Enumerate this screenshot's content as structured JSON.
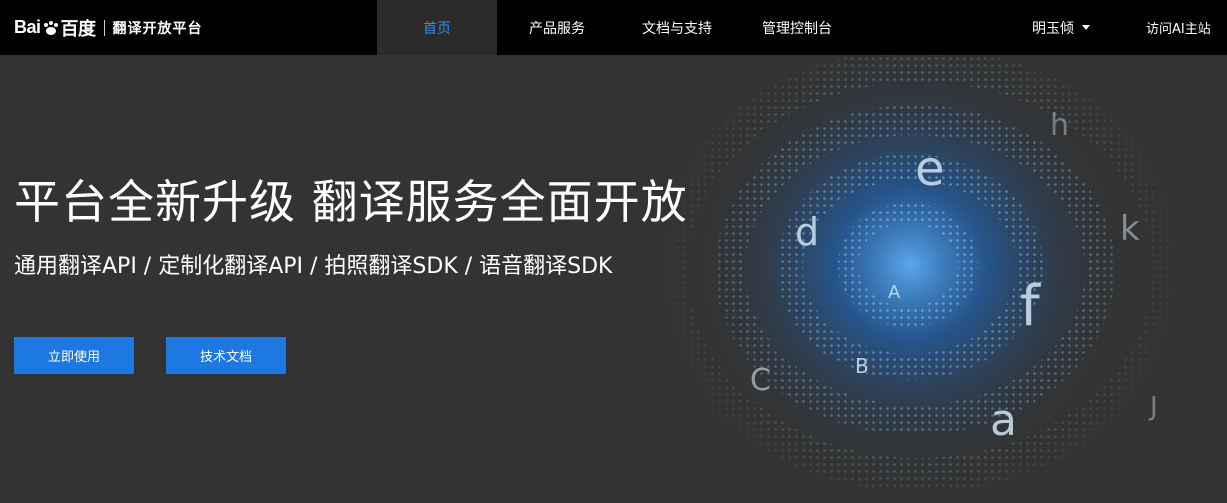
{
  "brand": {
    "logo_text_left": "Bai",
    "logo_text_right": "百度",
    "platform_name": "翻译开放平台"
  },
  "nav": {
    "items": [
      {
        "label": "首页",
        "active": true
      },
      {
        "label": "产品服务",
        "active": false
      },
      {
        "label": "文档与支持",
        "active": false
      },
      {
        "label": "管理控制台",
        "active": false
      }
    ]
  },
  "user": {
    "name": "明玉倾",
    "icon": "chevron-down-icon"
  },
  "visit_link": "访问AI主站",
  "hero": {
    "title": "平台全新升级 翻译服务全面开放",
    "subtitle": "通用翻译API / 定制化翻译API / 拍照翻译SDK / 语音翻译SDK",
    "primary_button": "立即使用",
    "secondary_button": "技术文档",
    "art_letters": [
      "h",
      "e",
      "d",
      "k",
      "A",
      "f",
      "B",
      "C",
      "a",
      "J"
    ]
  },
  "colors": {
    "topbar_bg": "#000000",
    "page_bg": "#333333",
    "accent": "#1d78e3",
    "active_nav_text": "#2f8cf5"
  }
}
